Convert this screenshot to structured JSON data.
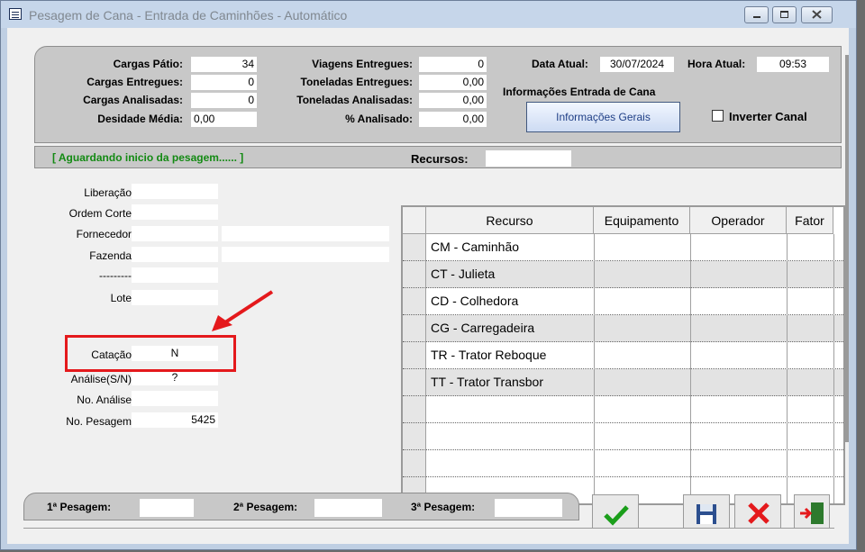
{
  "window": {
    "title": "Pesagem de Cana - Entrada de Caminhões - Automático"
  },
  "stats": {
    "cargas_patio_label": "Cargas Pátio:",
    "cargas_patio": "34",
    "cargas_entregues_label": "Cargas Entregues:",
    "cargas_entregues": "0",
    "cargas_analisadas_label": "Cargas Analisadas:",
    "cargas_analisadas": "0",
    "desidade_label": "Desidade Média:",
    "desidade": "0,00",
    "viagens_label": "Viagens Entregues:",
    "viagens": "0",
    "toneladas_entregues_label": "Toneladas Entregues:",
    "toneladas_entregues": "0,00",
    "toneladas_analisadas_label": "Toneladas Analisadas:",
    "toneladas_analisadas": "0,00",
    "analisado_label": "% Analisado:",
    "analisado": "0,00",
    "data_label": "Data Atual:",
    "data": "30/07/2024",
    "hora_label": "Hora Atual:",
    "hora": "09:53",
    "info_label": "Informações Entrada de Cana",
    "info_button": "Informações Gerais",
    "inverter_label": "Inverter Canal"
  },
  "status": {
    "message": "[ Aguardando inicio da pesagem...... ]",
    "recursos_label": "Recursos:",
    "recursos": ""
  },
  "form": {
    "liberacao_label": "Liberação",
    "liberacao": "",
    "ordem_label": "Ordem Corte",
    "ordem": "",
    "fornecedor_label": "Fornecedor",
    "fornecedor": "",
    "fornecedor_nome": "",
    "fazenda_label": "Fazenda",
    "fazenda": "",
    "fazenda_nome": "",
    "dash_label": "---------",
    "dash": "",
    "lote_label": "Lote",
    "lote": "",
    "catacao_label": "Catação",
    "catacao": "N",
    "analise_label": "Análise(S/N)",
    "analise": "?",
    "no_analise_label": "No. Análise",
    "no_analise": "",
    "no_pesagem_label": "No. Pesagem",
    "no_pesagem": "5425"
  },
  "grid": {
    "columns": [
      "Recurso",
      "Equipamento",
      "Operador",
      "Fator"
    ],
    "rows": [
      "CM - Caminhão",
      "CT - Julieta",
      "CD - Colhedora",
      "CG - Carregadeira",
      "TR - Trator Reboque",
      "TT - Trator Transbor",
      "",
      "",
      "",
      ""
    ]
  },
  "pesagem": {
    "p1_label": "1ª Pesagem:",
    "p1": "",
    "p2_label": "2ª Pesagem:",
    "p2": "",
    "p3_label": "3ª Pesagem:",
    "p3": ""
  },
  "colors": {
    "status_green": "#138a13",
    "highlight_red": "#e4191c",
    "link_blue": "#1f3f86"
  }
}
